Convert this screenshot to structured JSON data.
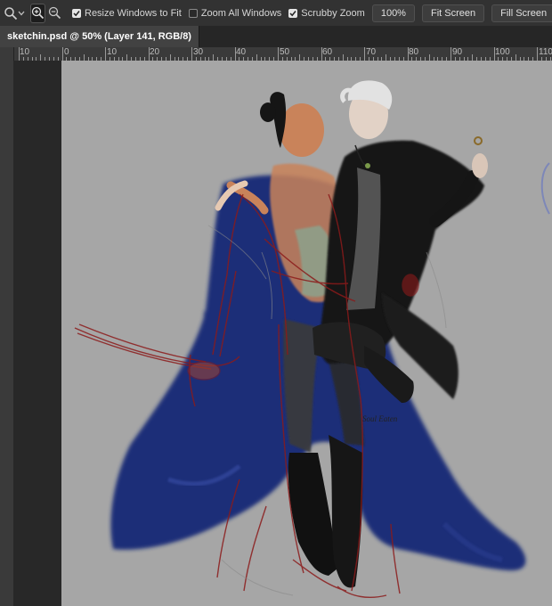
{
  "options_bar": {
    "tool_icon": "zoom-magnifier-icon",
    "zoom_in_icon": "zoom-in-icon",
    "zoom_out_icon": "zoom-out-icon",
    "resize_windows_label": "Resize Windows to Fit",
    "resize_windows_checked": true,
    "zoom_all_windows_label": "Zoom All Windows",
    "zoom_all_windows_checked": false,
    "scrubby_zoom_label": "Scrubby Zoom",
    "scrubby_zoom_checked": true,
    "zoom_100_label": "100%",
    "fit_screen_label": "Fit Screen",
    "fill_screen_label": "Fill Screen"
  },
  "document_tab": {
    "title": "sketchin.psd @ 50% (Layer 141, RGB/8)"
  },
  "ruler": {
    "ticks": [
      "10",
      "0",
      "10",
      "20",
      "30",
      "40",
      "50",
      "60",
      "70",
      "80",
      "90",
      "100",
      "110"
    ]
  },
  "canvas": {
    "signature_text": "Soul Eaten",
    "colors": {
      "canvas_bg": "#a6a6a6",
      "coat_blue": "#1f2f78",
      "sketch_red": "#8c1b1b",
      "skin": "#c9835a",
      "black_coat": "#151515",
      "white_hair": "#e2e2e2"
    }
  }
}
